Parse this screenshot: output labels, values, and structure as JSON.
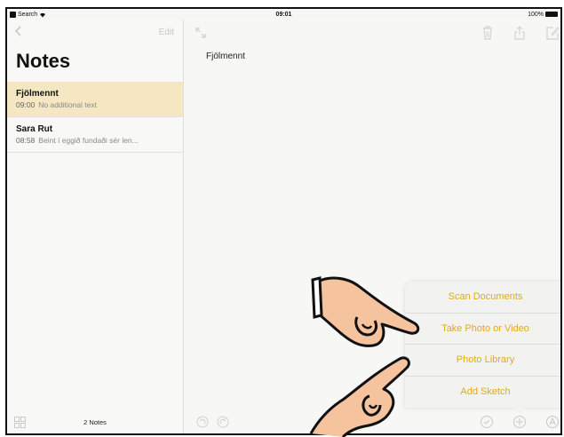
{
  "status_bar": {
    "back_label": "Search",
    "time": "09:01",
    "battery": "100%"
  },
  "sidebar": {
    "edit_label": "Edit",
    "title": "Notes",
    "notes": [
      {
        "title": "Fjölmennt",
        "time": "09:00",
        "preview": "No additional text",
        "selected": true
      },
      {
        "title": "Sara Rut",
        "time": "08:58",
        "preview": "Beint í eggið fundaði sér len...",
        "selected": false
      }
    ],
    "count_label": "2 Notes"
  },
  "note": {
    "title": "Fjölmennt"
  },
  "popup_menu": {
    "items": [
      "Scan Documents",
      "Take Photo or Video",
      "Photo Library",
      "Add Sketch"
    ],
    "color": "#e2a91d"
  },
  "colors": {
    "accent": "#e2a91d",
    "selected_note_bg": "#f4e7c2"
  }
}
